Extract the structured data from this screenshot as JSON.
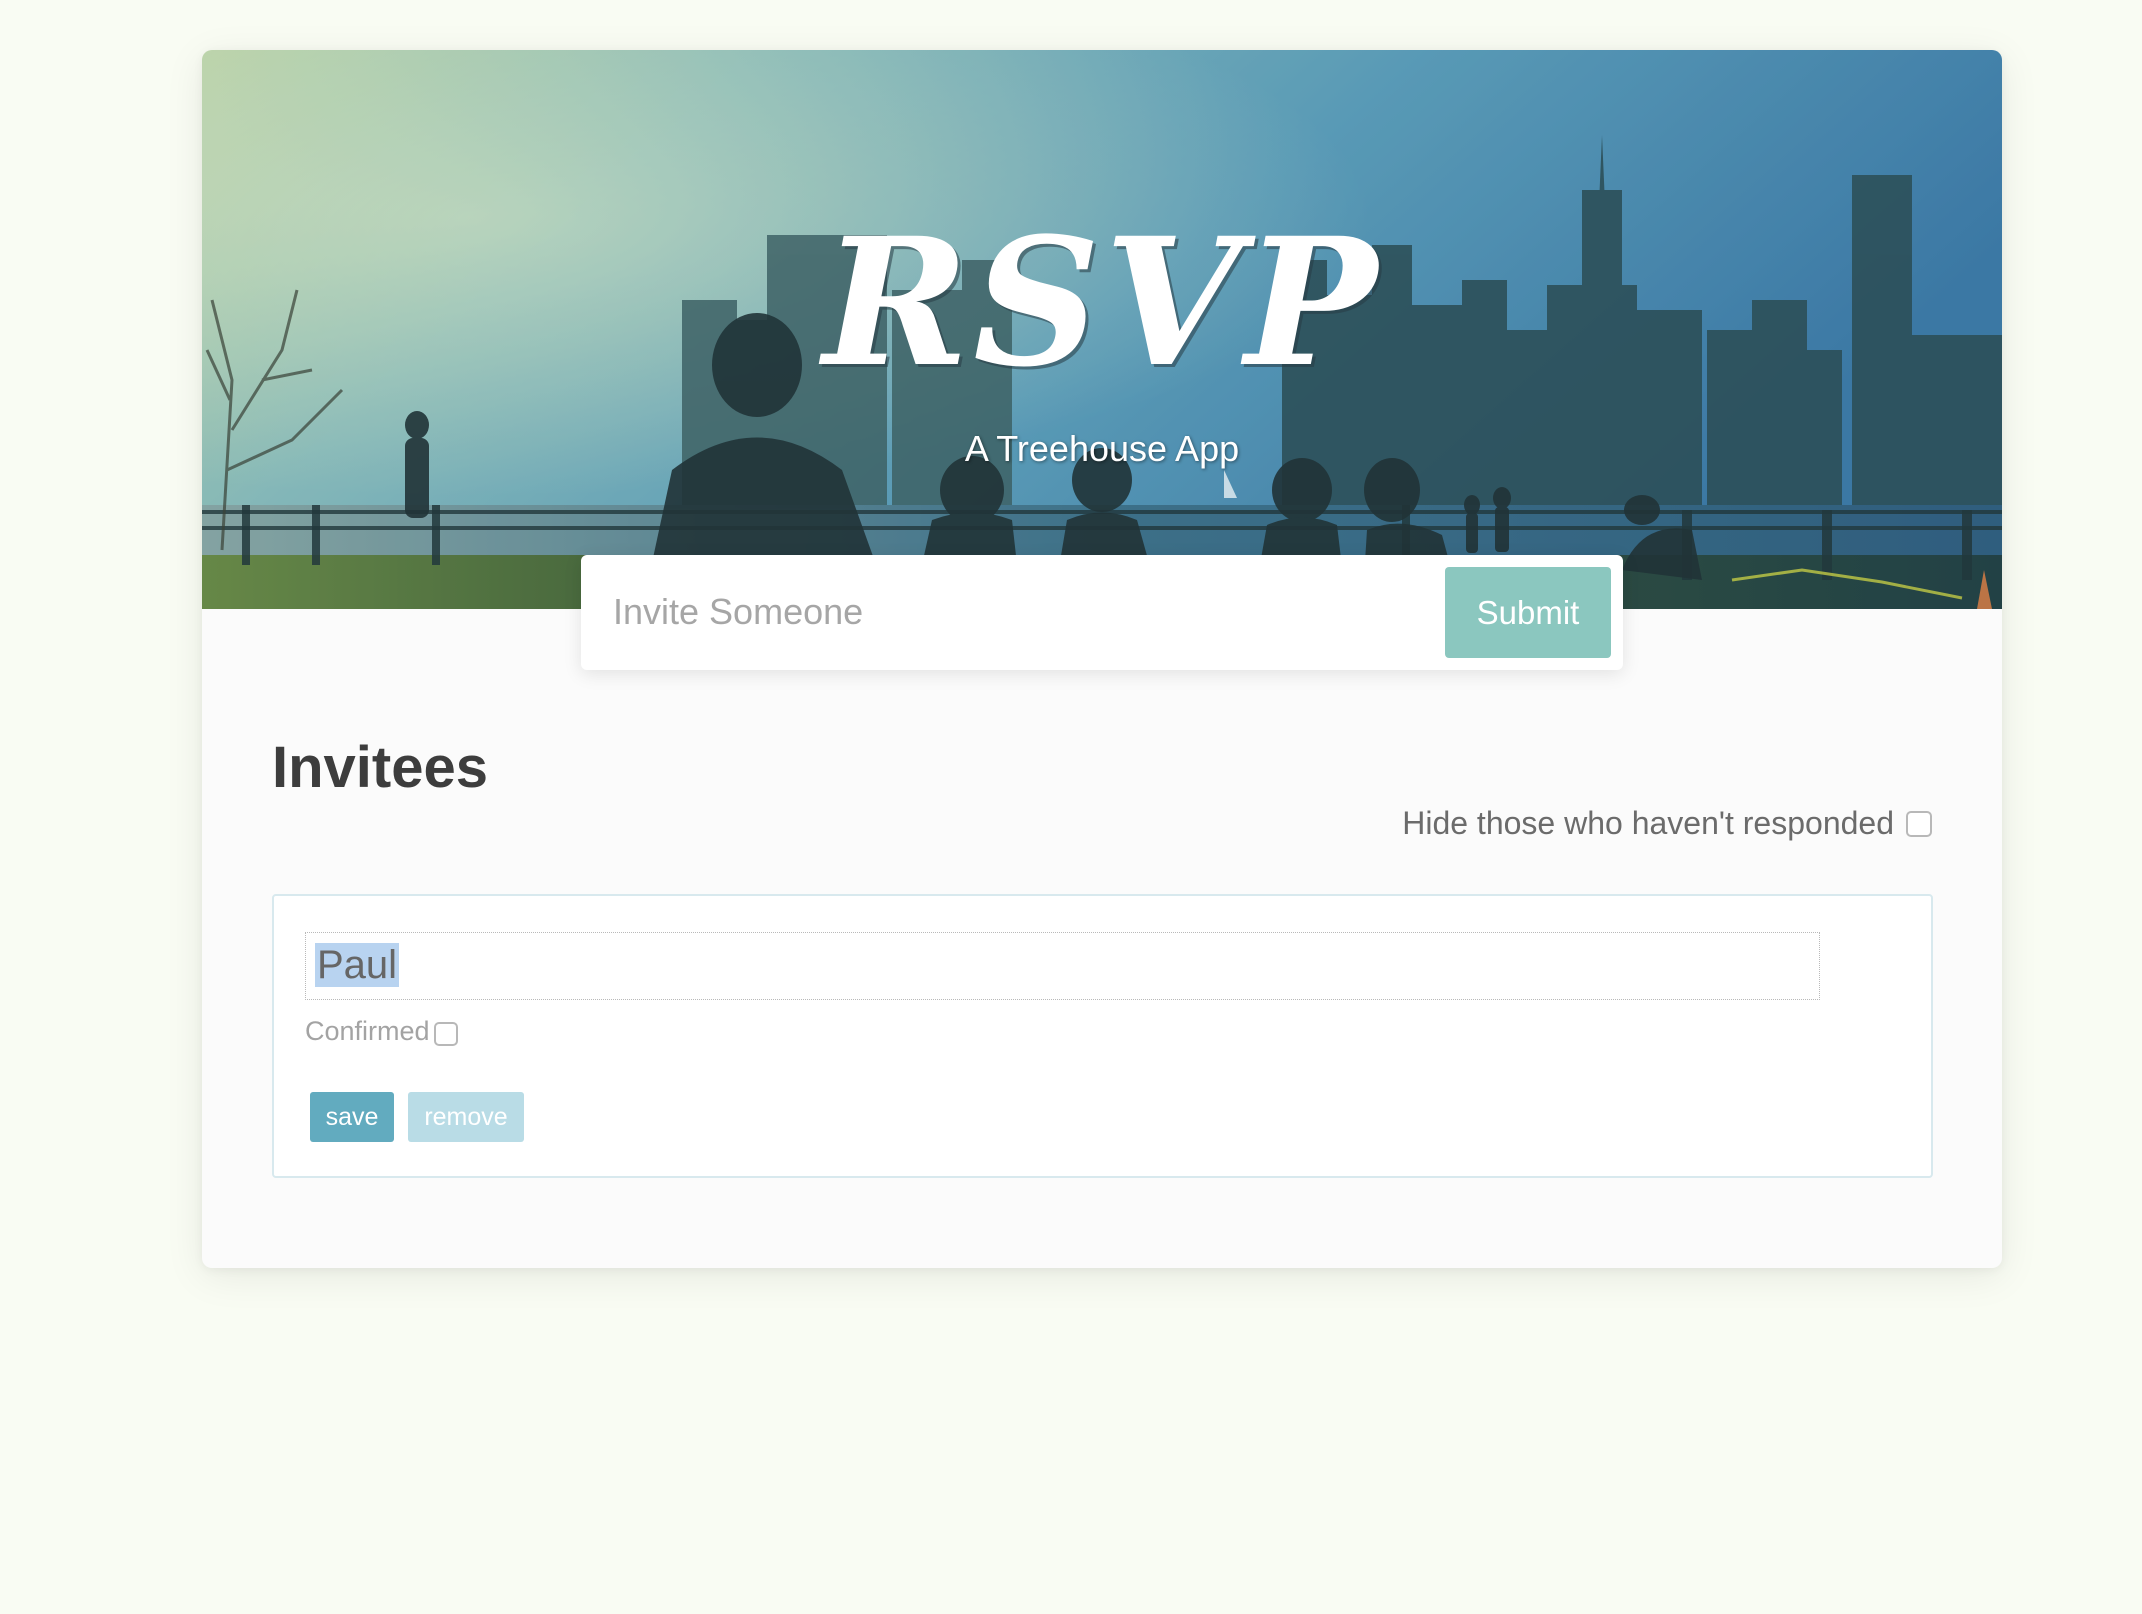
{
  "header": {
    "title": "RSVP",
    "subtitle": "A Treehouse App",
    "background_image": "city-skyline-park-photo"
  },
  "invite_form": {
    "placeholder": "Invite Someone",
    "value": "",
    "submit_label": "Submit"
  },
  "main": {
    "heading": "Invitees",
    "filter_label": "Hide those who haven't responded",
    "filter_checked": false
  },
  "invitees": [
    {
      "name": "Paul",
      "name_selected": true,
      "confirmed_label": "Confirmed",
      "confirmed": false,
      "save_label": "save",
      "remove_label": "remove"
    }
  ],
  "colors": {
    "page_background": "#f9fcf3",
    "card_background": "#fbfbfb",
    "accent_submit": "#8bc7bf",
    "save_button": "#62abbf",
    "remove_button": "#b9dce6",
    "selection_highlight": "#b8d3f0"
  }
}
